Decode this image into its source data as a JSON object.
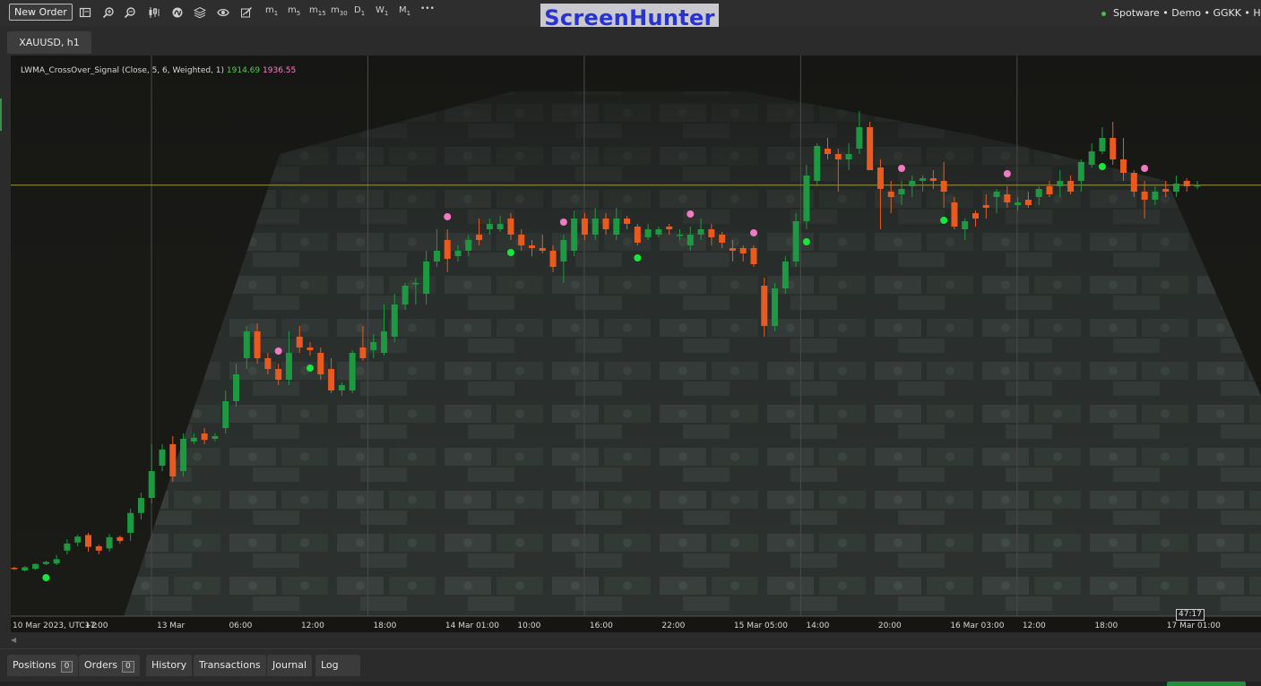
{
  "toolbar": {
    "new_order_label": "New Order",
    "icons": [
      "layout-icon",
      "zoom-in-icon",
      "zoom-out-icon",
      "chart-type-icon",
      "indicators-icon",
      "layers-icon",
      "eye-icon",
      "drawing-tools-icon"
    ],
    "timeframes": [
      {
        "main": "m",
        "sub": "1"
      },
      {
        "main": "m",
        "sub": "5"
      },
      {
        "main": "m",
        "sub": "15"
      },
      {
        "main": "m",
        "sub": "30"
      },
      {
        "main": "D",
        "sub": "1"
      },
      {
        "main": "W",
        "sub": "1"
      },
      {
        "main": "M",
        "sub": "1"
      }
    ],
    "more_label": "•••",
    "brand": "ScreenHunter",
    "account": "Spotware • Demo • GGKK • Hedging"
  },
  "chart_tab": {
    "label": "XAUUSD, h1"
  },
  "indicator": {
    "name": "LWMA_CrossOver_Signal (Close, 5, 6, Weighted, 1)",
    "value_1": "1914.69",
    "value_2": "1936.55",
    "value_1_color": "#4bd24b",
    "value_2_color": "#ff7fc8"
  },
  "chart_data": {
    "type": "candlestick",
    "symbol": "XAUUSD",
    "timeframe": "h1",
    "x_ticks": [
      "10 Mar 2023, UTC+2",
      "17:00",
      "13 Mar",
      "06:00",
      "12:00",
      "18:00",
      "14 Mar 01:00",
      "10:00",
      "16:00",
      "22:00",
      "15 Mar 05:00",
      "14:00",
      "20:00",
      "16 Mar 03:00",
      "12:00",
      "18:00",
      "17 Mar 01:00"
    ],
    "candles": [
      {
        "o": 0.07,
        "c": 0.068,
        "h": 0.072,
        "l": 0.066
      },
      {
        "o": 0.065,
        "c": 0.071,
        "h": 0.073,
        "l": 0.063
      },
      {
        "o": 0.068,
        "c": 0.077,
        "h": 0.078,
        "l": 0.066
      },
      {
        "o": 0.077,
        "c": 0.081,
        "h": 0.083,
        "l": 0.075
      },
      {
        "o": 0.078,
        "c": 0.086,
        "h": 0.094,
        "l": 0.075
      },
      {
        "o": 0.102,
        "c": 0.115,
        "h": 0.123,
        "l": 0.095
      },
      {
        "o": 0.117,
        "c": 0.128,
        "h": 0.132,
        "l": 0.11
      },
      {
        "o": 0.131,
        "c": 0.109,
        "h": 0.135,
        "l": 0.1
      },
      {
        "o": 0.11,
        "c": 0.102,
        "h": 0.113,
        "l": 0.095
      },
      {
        "o": 0.106,
        "c": 0.127,
        "h": 0.133,
        "l": 0.1
      },
      {
        "o": 0.127,
        "c": 0.12,
        "h": 0.13,
        "l": 0.115
      },
      {
        "o": 0.135,
        "c": 0.172,
        "h": 0.18,
        "l": 0.12
      },
      {
        "o": 0.172,
        "c": 0.2,
        "h": 0.21,
        "l": 0.16
      },
      {
        "o": 0.2,
        "c": 0.25,
        "h": 0.3,
        "l": 0.19
      },
      {
        "o": 0.26,
        "c": 0.29,
        "h": 0.3,
        "l": 0.25
      },
      {
        "o": 0.3,
        "c": 0.24,
        "h": 0.315,
        "l": 0.23
      },
      {
        "o": 0.25,
        "c": 0.31,
        "h": 0.32,
        "l": 0.24
      },
      {
        "o": 0.305,
        "c": 0.312,
        "h": 0.32,
        "l": 0.3
      },
      {
        "o": 0.32,
        "c": 0.308,
        "h": 0.33,
        "l": 0.3
      },
      {
        "o": 0.31,
        "c": 0.315,
        "h": 0.32,
        "l": 0.305
      },
      {
        "o": 0.33,
        "c": 0.38,
        "h": 0.4,
        "l": 0.32
      },
      {
        "o": 0.38,
        "c": 0.43,
        "h": 0.45,
        "l": 0.37
      },
      {
        "o": 0.46,
        "c": 0.51,
        "h": 0.52,
        "l": 0.44
      },
      {
        "o": 0.51,
        "c": 0.46,
        "h": 0.525,
        "l": 0.45
      },
      {
        "o": 0.46,
        "c": 0.44,
        "h": 0.47,
        "l": 0.43
      },
      {
        "o": 0.44,
        "c": 0.42,
        "h": 0.45,
        "l": 0.41
      },
      {
        "o": 0.42,
        "c": 0.47,
        "h": 0.51,
        "l": 0.41
      },
      {
        "o": 0.5,
        "c": 0.48,
        "h": 0.52,
        "l": 0.47
      },
      {
        "o": 0.48,
        "c": 0.475,
        "h": 0.49,
        "l": 0.465
      },
      {
        "o": 0.47,
        "c": 0.43,
        "h": 0.48,
        "l": 0.42
      },
      {
        "o": 0.44,
        "c": 0.4,
        "h": 0.46,
        "l": 0.395
      },
      {
        "o": 0.4,
        "c": 0.41,
        "h": 0.415,
        "l": 0.39
      },
      {
        "o": 0.4,
        "c": 0.47,
        "h": 0.475,
        "l": 0.395
      },
      {
        "o": 0.48,
        "c": 0.46,
        "h": 0.52,
        "l": 0.455
      },
      {
        "o": 0.475,
        "c": 0.49,
        "h": 0.505,
        "l": 0.46
      },
      {
        "o": 0.47,
        "c": 0.51,
        "h": 0.56,
        "l": 0.465
      },
      {
        "o": 0.5,
        "c": 0.56,
        "h": 0.58,
        "l": 0.49
      },
      {
        "o": 0.56,
        "c": 0.595,
        "h": 0.6,
        "l": 0.55
      },
      {
        "o": 0.6,
        "c": 0.6,
        "h": 0.61,
        "l": 0.56
      },
      {
        "o": 0.58,
        "c": 0.64,
        "h": 0.66,
        "l": 0.56
      },
      {
        "o": 0.64,
        "c": 0.66,
        "h": 0.7,
        "l": 0.63
      },
      {
        "o": 0.68,
        "c": 0.645,
        "h": 0.7,
        "l": 0.62
      },
      {
        "o": 0.65,
        "c": 0.66,
        "h": 0.67,
        "l": 0.64
      },
      {
        "o": 0.66,
        "c": 0.68,
        "h": 0.69,
        "l": 0.65
      },
      {
        "o": 0.69,
        "c": 0.68,
        "h": 0.72,
        "l": 0.67
      },
      {
        "o": 0.7,
        "c": 0.71,
        "h": 0.72,
        "l": 0.69
      },
      {
        "o": 0.7,
        "c": 0.71,
        "h": 0.725,
        "l": 0.695
      },
      {
        "o": 0.72,
        "c": 0.69,
        "h": 0.73,
        "l": 0.68
      },
      {
        "o": 0.69,
        "c": 0.67,
        "h": 0.7,
        "l": 0.66
      },
      {
        "o": 0.67,
        "c": 0.665,
        "h": 0.68,
        "l": 0.65
      },
      {
        "o": 0.665,
        "c": 0.66,
        "h": 0.69,
        "l": 0.655
      },
      {
        "o": 0.66,
        "c": 0.63,
        "h": 0.67,
        "l": 0.62
      },
      {
        "o": 0.64,
        "c": 0.68,
        "h": 0.69,
        "l": 0.6
      },
      {
        "o": 0.66,
        "c": 0.72,
        "h": 0.735,
        "l": 0.65
      },
      {
        "o": 0.72,
        "c": 0.69,
        "h": 0.73,
        "l": 0.68
      },
      {
        "o": 0.69,
        "c": 0.72,
        "h": 0.74,
        "l": 0.68
      },
      {
        "o": 0.72,
        "c": 0.7,
        "h": 0.73,
        "l": 0.69
      },
      {
        "o": 0.69,
        "c": 0.72,
        "h": 0.74,
        "l": 0.68
      },
      {
        "o": 0.72,
        "c": 0.71,
        "h": 0.725,
        "l": 0.7
      },
      {
        "o": 0.705,
        "c": 0.675,
        "h": 0.71,
        "l": 0.67
      },
      {
        "o": 0.685,
        "c": 0.7,
        "h": 0.71,
        "l": 0.68
      },
      {
        "o": 0.69,
        "c": 0.7,
        "h": 0.705,
        "l": 0.685
      },
      {
        "o": 0.705,
        "c": 0.7,
        "h": 0.71,
        "l": 0.69
      },
      {
        "o": 0.69,
        "c": 0.69,
        "h": 0.7,
        "l": 0.68
      },
      {
        "o": 0.67,
        "c": 0.69,
        "h": 0.705,
        "l": 0.66
      },
      {
        "o": 0.69,
        "c": 0.7,
        "h": 0.72,
        "l": 0.68
      },
      {
        "o": 0.7,
        "c": 0.685,
        "h": 0.71,
        "l": 0.67
      },
      {
        "o": 0.69,
        "c": 0.675,
        "h": 0.695,
        "l": 0.665
      },
      {
        "o": 0.665,
        "c": 0.66,
        "h": 0.68,
        "l": 0.64
      },
      {
        "o": 0.665,
        "c": 0.655,
        "h": 0.67,
        "l": 0.64
      },
      {
        "o": 0.665,
        "c": 0.635,
        "h": 0.67,
        "l": 0.63
      },
      {
        "o": 0.595,
        "c": 0.52,
        "h": 0.61,
        "l": 0.5
      },
      {
        "o": 0.52,
        "c": 0.59,
        "h": 0.6,
        "l": 0.51
      },
      {
        "o": 0.59,
        "c": 0.64,
        "h": 0.65,
        "l": 0.58
      },
      {
        "o": 0.64,
        "c": 0.715,
        "h": 0.73,
        "l": 0.63
      },
      {
        "o": 0.715,
        "c": 0.8,
        "h": 0.82,
        "l": 0.7
      },
      {
        "o": 0.79,
        "c": 0.855,
        "h": 0.86,
        "l": 0.78
      },
      {
        "o": 0.85,
        "c": 0.84,
        "h": 0.87,
        "l": 0.83
      },
      {
        "o": 0.84,
        "c": 0.83,
        "h": 0.85,
        "l": 0.77
      },
      {
        "o": 0.83,
        "c": 0.84,
        "h": 0.86,
        "l": 0.81
      },
      {
        "o": 0.85,
        "c": 0.89,
        "h": 0.92,
        "l": 0.84
      },
      {
        "o": 0.89,
        "c": 0.81,
        "h": 0.9,
        "l": 0.82
      },
      {
        "o": 0.815,
        "c": 0.775,
        "h": 0.83,
        "l": 0.7
      },
      {
        "o": 0.77,
        "c": 0.76,
        "h": 0.79,
        "l": 0.73
      },
      {
        "o": 0.765,
        "c": 0.775,
        "h": 0.79,
        "l": 0.745
      },
      {
        "o": 0.78,
        "c": 0.79,
        "h": 0.8,
        "l": 0.76
      },
      {
        "o": 0.79,
        "c": 0.795,
        "h": 0.8,
        "l": 0.77
      },
      {
        "o": 0.795,
        "c": 0.79,
        "h": 0.81,
        "l": 0.775
      },
      {
        "o": 0.79,
        "c": 0.77,
        "h": 0.825,
        "l": 0.74
      },
      {
        "o": 0.75,
        "c": 0.705,
        "h": 0.76,
        "l": 0.7
      },
      {
        "o": 0.7,
        "c": 0.715,
        "h": 0.72,
        "l": 0.68
      },
      {
        "o": 0.73,
        "c": 0.72,
        "h": 0.735,
        "l": 0.705
      },
      {
        "o": 0.745,
        "c": 0.74,
        "h": 0.765,
        "l": 0.72
      },
      {
        "o": 0.76,
        "c": 0.77,
        "h": 0.775,
        "l": 0.73
      },
      {
        "o": 0.765,
        "c": 0.75,
        "h": 0.78,
        "l": 0.74
      },
      {
        "o": 0.745,
        "c": 0.75,
        "h": 0.76,
        "l": 0.735
      },
      {
        "o": 0.755,
        "c": 0.745,
        "h": 0.77,
        "l": 0.74
      },
      {
        "o": 0.76,
        "c": 0.775,
        "h": 0.78,
        "l": 0.745
      },
      {
        "o": 0.78,
        "c": 0.765,
        "h": 0.79,
        "l": 0.76
      },
      {
        "o": 0.78,
        "c": 0.79,
        "h": 0.81,
        "l": 0.76
      },
      {
        "o": 0.79,
        "c": 0.77,
        "h": 0.8,
        "l": 0.765
      },
      {
        "o": 0.79,
        "c": 0.825,
        "h": 0.83,
        "l": 0.77
      },
      {
        "o": 0.82,
        "c": 0.845,
        "h": 0.86,
        "l": 0.815
      },
      {
        "o": 0.845,
        "c": 0.87,
        "h": 0.89,
        "l": 0.84
      },
      {
        "o": 0.87,
        "c": 0.83,
        "h": 0.9,
        "l": 0.82
      },
      {
        "o": 0.83,
        "c": 0.805,
        "h": 0.87,
        "l": 0.79
      },
      {
        "o": 0.805,
        "c": 0.77,
        "h": 0.81,
        "l": 0.76
      },
      {
        "o": 0.77,
        "c": 0.755,
        "h": 0.79,
        "l": 0.72
      },
      {
        "o": 0.755,
        "c": 0.77,
        "h": 0.78,
        "l": 0.745
      },
      {
        "o": 0.775,
        "c": 0.77,
        "h": 0.79,
        "l": 0.76
      },
      {
        "o": 0.77,
        "c": 0.785,
        "h": 0.8,
        "l": 0.76
      },
      {
        "o": 0.79,
        "c": 0.78,
        "h": 0.795,
        "l": 0.77
      },
      {
        "o": 0.78,
        "c": 0.782,
        "h": 0.79,
        "l": 0.775
      }
    ],
    "candle_colors": {
      "up": "#1d9a41",
      "down": "#ea5a1f"
    },
    "buy_signals_at": [
      3,
      28,
      47,
      59,
      75,
      88,
      103
    ],
    "sell_signals_at": [
      25,
      41,
      52,
      64,
      70,
      84,
      94,
      107
    ],
    "signal_colors": {
      "buy": "#17e63d",
      "sell": "#f07ac4"
    },
    "current_price_level": 0.782,
    "current_price_line_color": "#9a9a44",
    "countdown": "47:17",
    "grid": "vertical only"
  },
  "bottom_tabs": [
    {
      "label": "Positions",
      "badge": "0"
    },
    {
      "label": "Orders",
      "badge": "0"
    },
    {
      "label": "History"
    },
    {
      "label": "Transactions"
    },
    {
      "label": "Journal"
    },
    {
      "label": "Log"
    }
  ]
}
